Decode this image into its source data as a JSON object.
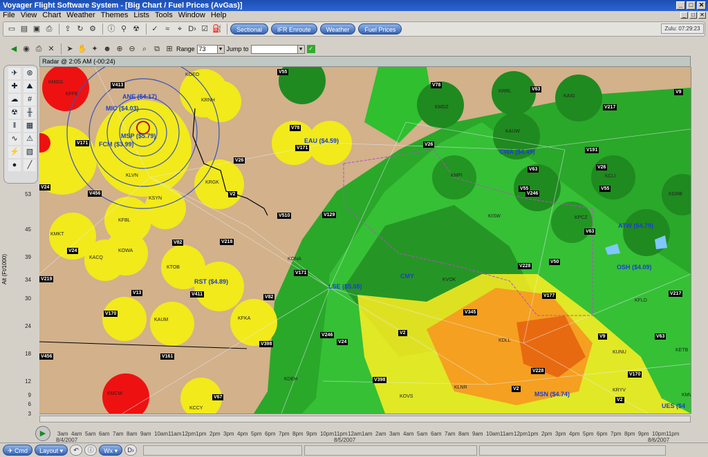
{
  "window": {
    "title": "Voyager Flight Software System - [Big Chart / Fuel Prices (AvGas)]",
    "min": "_",
    "max": "□",
    "close": "✕"
  },
  "menu": [
    "File",
    "View",
    "Chart",
    "Weather",
    "Themes",
    "Lists",
    "Tools",
    "Window",
    "Help"
  ],
  "toolbar": {
    "icons": [
      "new-icon",
      "open-icon",
      "save-icon",
      "print-icon",
      "import-icon",
      "refresh-icon",
      "settings-icon",
      "info-icon",
      "antenna-icon",
      "weather-radar-icon",
      "checkmark-icon",
      "route-icon",
      "nav-icon",
      "direct-to-icon",
      "checklist-icon",
      "fuel-icon"
    ],
    "chart_buttons": [
      "Sectional",
      "IFR Enroute",
      "Weather",
      "Fuel Prices"
    ],
    "zulu": "Zulu: 07:29:23"
  },
  "toolbar2": {
    "range_label": "Range",
    "range_value": "73",
    "jump_label": "Jump to",
    "jump_value": ""
  },
  "map": {
    "header": "Radar @ 2:05 AM (-00:24)",
    "altitude_axis_label": "Alt (Ft/1000)",
    "altitudes": [
      "53",
      "45",
      "39",
      "34",
      "30",
      "24",
      "18",
      "12",
      "9",
      "6",
      "3"
    ],
    "airports_fuel": [
      {
        "text": "ANE ($4.17)"
      },
      {
        "text": "MIC ($4.03)"
      },
      {
        "text": "MSP ($5.79)"
      },
      {
        "text": "FCM ($3.99)"
      },
      {
        "text": "EAU ($4.59)"
      },
      {
        "text": "CWA ($4.49)"
      },
      {
        "text": "ATW ($4.79)"
      },
      {
        "text": "OSH ($4.09)"
      },
      {
        "text": "RST ($4.89)"
      },
      {
        "text": "LSE ($5.08)"
      },
      {
        "text": "CMY"
      },
      {
        "text": "MSN ($4.74)"
      },
      {
        "text": "UES ($4"
      }
    ],
    "stations": [
      "KOEO",
      "KRNH",
      "KMGG",
      "KFFE",
      "KLVN",
      "KSYN",
      "KRGK",
      "KFBL",
      "KMKT",
      "KOWA",
      "KACQ",
      "KTOB",
      "KAUM",
      "KFKA",
      "KONA",
      "KVOK",
      "KMDZ",
      "KRRL",
      "KAUW",
      "KMFI",
      "KISW",
      "KPCZ",
      "KFLD",
      "KDLL",
      "KUNU",
      "KRYV",
      "KLNR",
      "KDEH",
      "KOVS",
      "KCCY",
      "KMCW",
      "KCLI",
      "KGRB",
      "KETB",
      "KAIG",
      "KMW"
    ],
    "victor_airways": [
      "V413",
      "V78",
      "V55",
      "V63",
      "V9",
      "V217",
      "V171",
      "V26",
      "V191",
      "V26",
      "V456",
      "V510",
      "V129",
      "V82",
      "V218",
      "V171",
      "V228",
      "V50",
      "V63",
      "V13",
      "V411",
      "V82",
      "V345",
      "V177",
      "V217",
      "V170",
      "V246",
      "V24",
      "V2",
      "V398",
      "V161",
      "V456",
      "V67",
      "V398",
      "V2",
      "V228",
      "V170",
      "V2",
      "V9",
      "V63",
      "V24",
      "V24",
      "V55",
      "V246",
      "V171",
      "V78",
      "V55",
      "V26",
      "V63",
      "V2",
      "V219",
      "V26",
      "V78"
    ]
  },
  "timeline": {
    "hours": [
      "3am",
      "4am",
      "5am",
      "6am",
      "7am",
      "8am",
      "9am",
      "10am",
      "11am",
      "12pm",
      "1pm",
      "2pm",
      "3pm",
      "4pm",
      "5pm",
      "6pm",
      "7pm",
      "8pm",
      "9pm",
      "10pm",
      "11pm",
      "12am",
      "1am",
      "2am",
      "3am",
      "4am",
      "5am",
      "6am",
      "7am",
      "8am",
      "9am",
      "10am",
      "11am",
      "12pm",
      "1pm",
      "2pm",
      "3pm",
      "4pm",
      "5pm",
      "6pm",
      "7pm",
      "8pm",
      "9pm",
      "10pm",
      "11pm",
      "12am",
      "1am"
    ],
    "dates": [
      "8/4/2007",
      "8/5/2007",
      "8/6/2007"
    ]
  },
  "bottom": {
    "cmd": "Cmd",
    "layout": "Layout",
    "wx": "Wx"
  }
}
